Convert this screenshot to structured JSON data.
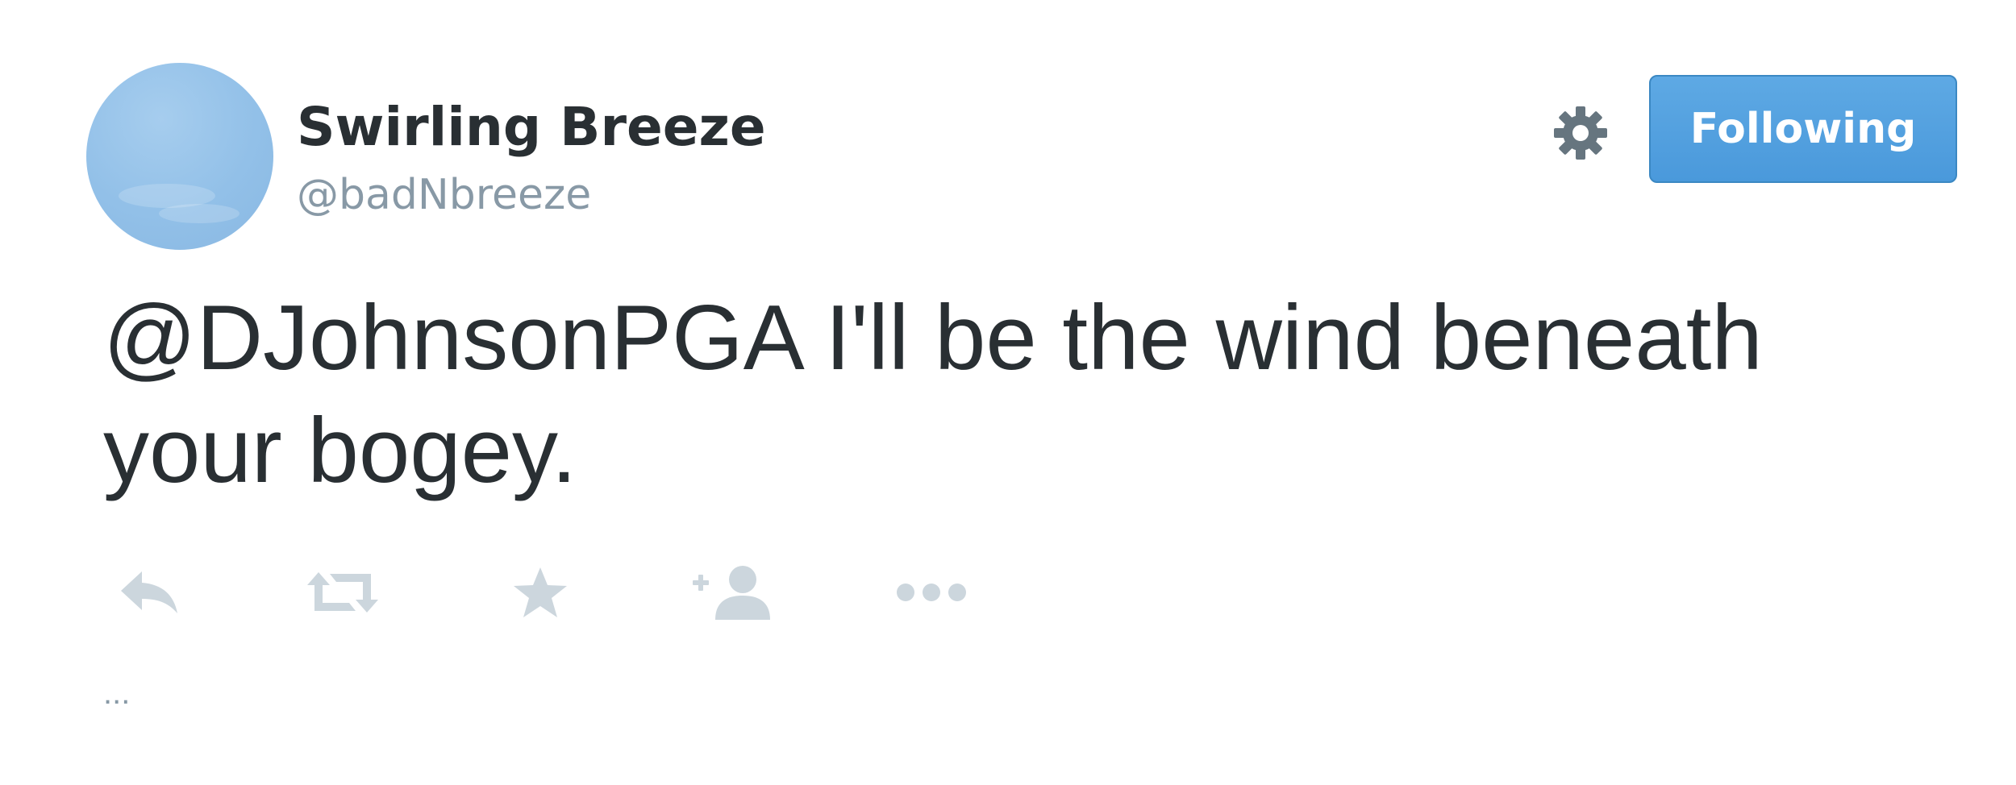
{
  "user": {
    "display_name": "Swirling Breeze",
    "handle": "@badNbreeze",
    "avatar_icon": "sky-avatar",
    "avatar_color": "#92c0e8"
  },
  "header": {
    "settings_icon": "gear-icon",
    "follow_label": "Following",
    "follow_color": "#4a99db"
  },
  "tweet": {
    "text": "@DJohnsonPGA I'll be the wind beneath your bogey."
  },
  "actions": [
    {
      "name": "reply",
      "icon": "reply-icon"
    },
    {
      "name": "retweet",
      "icon": "retweet-icon"
    },
    {
      "name": "favorite",
      "icon": "star-icon"
    },
    {
      "name": "follow",
      "icon": "add-user-icon"
    },
    {
      "name": "more",
      "icon": "more-icon"
    }
  ],
  "footer": {
    "ellipsis": "..."
  },
  "colors": {
    "text": "#292f33",
    "muted": "#8899a6",
    "action_icon": "#ccd6dd"
  }
}
